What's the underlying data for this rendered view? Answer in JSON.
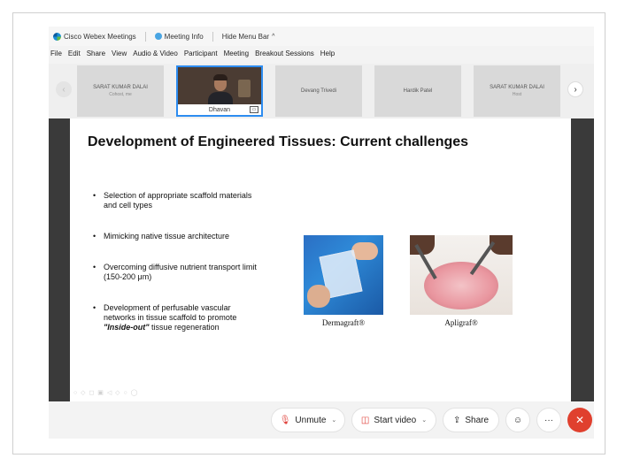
{
  "titlebar": {
    "app_name": "Cisco Webex Meetings",
    "meeting_info": "Meeting Info",
    "hide_menu": "Hide Menu Bar"
  },
  "menu": [
    "File",
    "Edit",
    "Share",
    "View",
    "Audio & Video",
    "Participant",
    "Meeting",
    "Breakout Sessions",
    "Help"
  ],
  "participants": [
    {
      "name": "SARAT KUMAR DALAI",
      "sub": "Cohost, me"
    },
    {
      "name": "Dhavan",
      "video": true
    },
    {
      "name": "Devang Trivedi"
    },
    {
      "name": "Hardik Patel"
    },
    {
      "name": "SARAT KUMAR DALAI",
      "sub": "Host"
    }
  ],
  "slide": {
    "title": "Development of Engineered Tissues: Current challenges",
    "bullets": [
      "Selection of appropriate scaffold materials and cell types",
      "Mimicking native tissue architecture",
      "Overcoming diffusive nutrient transport limit (150-200 μm)",
      "Development of perfusable vascular networks in tissue scaffold to promote"
    ],
    "bullet4_em": "\"Inside-out\"",
    "bullet4_tail": "tissue regeneration",
    "captions": [
      "Dermagraft®",
      "Apligraf®"
    ]
  },
  "controls": {
    "unmute": "Unmute",
    "start_video": "Start video",
    "share": "Share"
  },
  "colors": {
    "end_call": "#e0402e",
    "active_border": "#2d8cf0",
    "mute_icon": "#e0403a"
  }
}
